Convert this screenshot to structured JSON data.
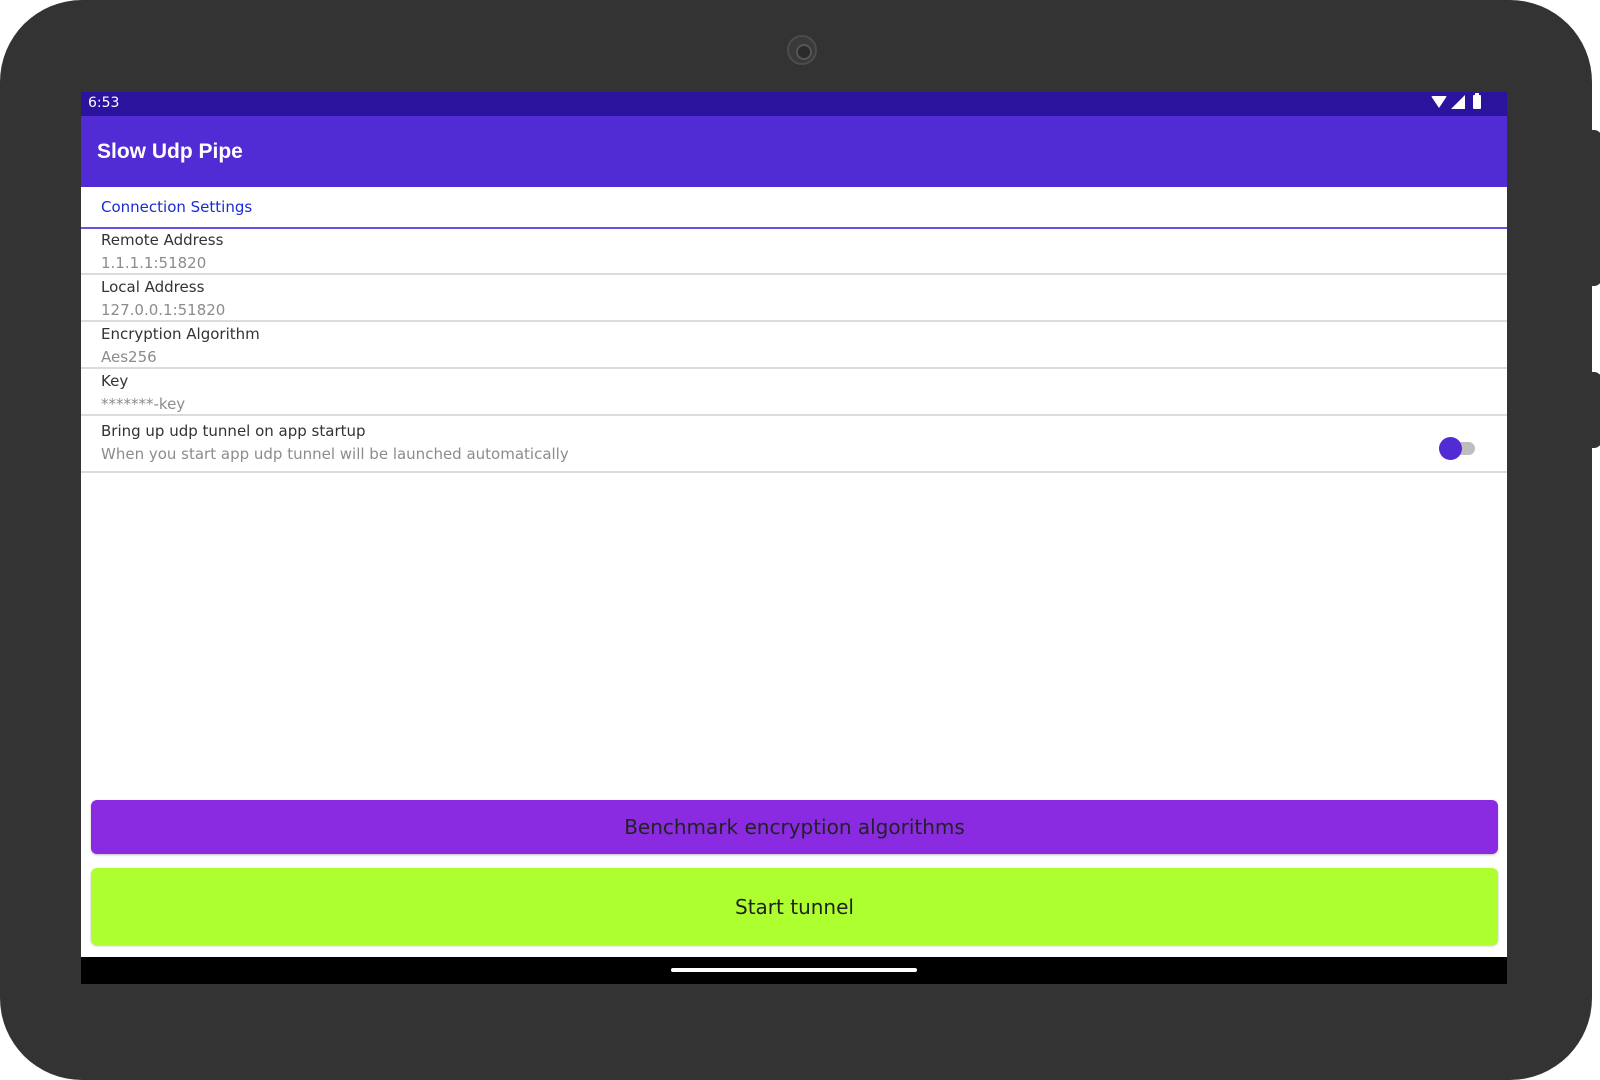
{
  "status_bar": {
    "time": "6:53",
    "icons": [
      "wifi-icon",
      "signal-icon",
      "battery-icon"
    ],
    "color": "#2b139e"
  },
  "app_bar": {
    "title": "Slow Udp Pipe",
    "color": "#512bd4"
  },
  "section": {
    "title": "Connection Settings"
  },
  "settings": [
    {
      "title": "Remote Address",
      "value": "1.1.1.1:51820"
    },
    {
      "title": "Local Address",
      "value": "127.0.0.1:51820"
    },
    {
      "title": "Encryption Algorithm",
      "value": "Aes256"
    },
    {
      "title": "Key",
      "value": "*******-key"
    },
    {
      "title": "Bring up udp tunnel on app startup",
      "value": "When you start app udp tunnel will be launched automatically",
      "toggle_on": true
    }
  ],
  "buttons": {
    "benchmark": {
      "label": "Benchmark encryption algorithms",
      "color": "#8a2be2"
    },
    "start": {
      "label": "Start tunnel",
      "color": "#adff2f"
    }
  }
}
